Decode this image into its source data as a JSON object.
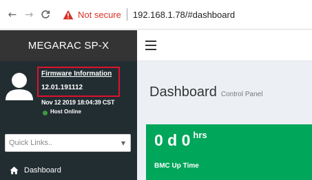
{
  "browser": {
    "security_label": "Not secure",
    "url": "192.168.1.78/#dashboard"
  },
  "sidebar": {
    "brand": "MEGARAC SP-X",
    "firmware_link": "Firmware Information",
    "firmware_version": "12.01.191112",
    "firmware_date": "Nov 12 2019 18:04:39 CST",
    "host_status": "Host Online",
    "quick_links_placeholder": "Quick Links..",
    "nav_dashboard": "Dashboard"
  },
  "header": {
    "title": "Dashboard",
    "subtitle": "Control Panel"
  },
  "tile": {
    "uptime_value": "0 d 0",
    "uptime_unit": "hrs",
    "label": "BMC Up Time"
  },
  "colors": {
    "sidebar_bg": "#222d32",
    "brand_bg": "#343434",
    "tile_green": "#00a65a",
    "highlight_red": "#e0112b",
    "not_secure_red": "#d93025",
    "host_online_green": "#3c9b3c"
  }
}
